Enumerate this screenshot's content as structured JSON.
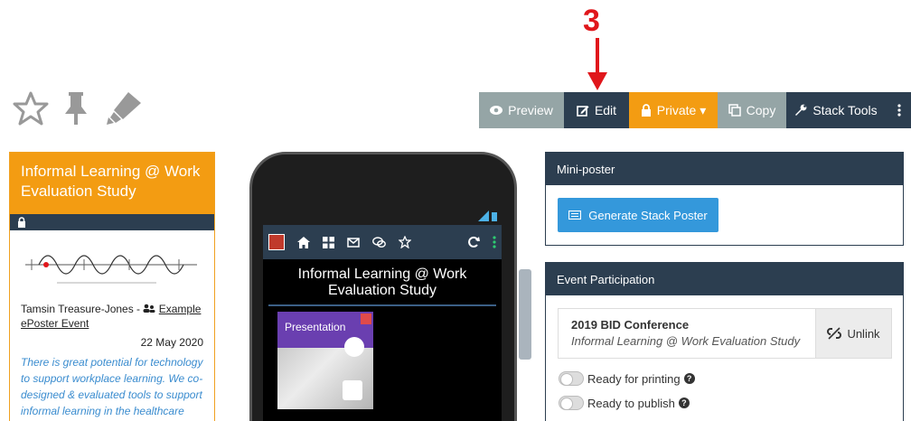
{
  "annotation": {
    "step_number": "3"
  },
  "toolbar": {
    "preview_label": "Preview",
    "edit_label": "Edit",
    "private_label": "Private ▾",
    "copy_label": "Copy",
    "stack_tools_label": "Stack Tools",
    "more_icon": "ellipsis-vertical-icon"
  },
  "top_icons": [
    "star-icon",
    "pin-icon",
    "highlighter-icon"
  ],
  "left_card": {
    "title": "Informal Learning @ Work Evaluation Study",
    "author": "Tamsin Treasure-Jones -",
    "event_link": "Example ePoster Event",
    "date": "22 May 2020",
    "description": "There is great potential for technology to support workplace learning. We co-designed & evaluated tools to support informal learning in the healthcare workplace."
  },
  "phone": {
    "title": "Informal Learning @ Work Evaluation Study",
    "card_label": "Presentation"
  },
  "mini_poster": {
    "heading": "Mini-poster",
    "button_label": "Generate Stack Poster"
  },
  "event_participation": {
    "heading": "Event Participation",
    "event_name": "2019 BID Conference",
    "event_subtitle": "Informal Learning @ Work Evaluation Study",
    "unlink_label": "Unlink",
    "ready_printing": "Ready for printing",
    "ready_publish": "Ready to publish"
  },
  "colors": {
    "accent_orange": "#f39c12",
    "dark_navy": "#2c3e50",
    "grey": "#95a5a6",
    "blue": "#3498db",
    "annotation_red": "#e0161b"
  }
}
